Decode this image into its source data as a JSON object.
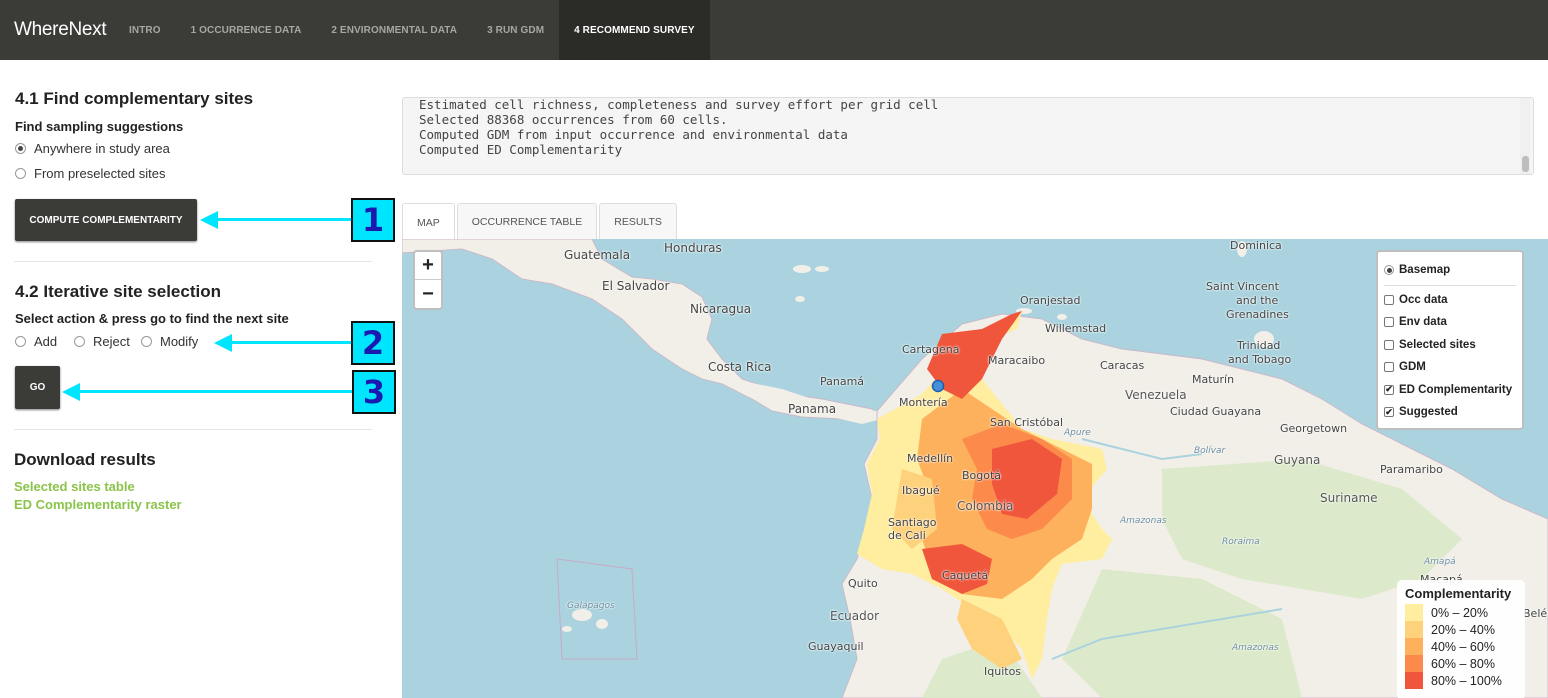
{
  "app": {
    "title": "WhereNext"
  },
  "nav": {
    "tabs": [
      {
        "label": "INTRO"
      },
      {
        "label": "1 OCCURRENCE DATA"
      },
      {
        "label": "2 ENVIRONMENTAL DATA"
      },
      {
        "label": "3 RUN GDM"
      },
      {
        "label": "4 RECOMMEND SURVEY"
      }
    ],
    "active_index": 4
  },
  "section1": {
    "title": "4.1 Find complementary sites",
    "subtitle": "Find sampling suggestions",
    "options": [
      {
        "label": "Anywhere in study area",
        "selected": true
      },
      {
        "label": "From preselected sites",
        "selected": false
      }
    ],
    "button_label": "COMPUTE COMPLEMENTARITY"
  },
  "section2": {
    "title": "4.2 Iterative site selection",
    "subtitle": "Select action & press go to find the next site",
    "options": [
      {
        "label": "Add",
        "selected": false
      },
      {
        "label": "Reject",
        "selected": false
      },
      {
        "label": "Modify",
        "selected": false
      }
    ],
    "button_label": "GO"
  },
  "download": {
    "title": "Download results",
    "links": [
      {
        "label": "Selected sites table"
      },
      {
        "label": "ED Complementarity raster"
      }
    ]
  },
  "annotations": [
    "1",
    "2",
    "3"
  ],
  "log": {
    "lines": [
      "Estimated cell richness, completeness and survey effort per grid cell",
      "Selected 88368 occurrences from 60 cells.",
      "Computed GDM from input occurrence and environmental data",
      "Computed ED Complementarity"
    ]
  },
  "tabs": [
    {
      "label": "MAP"
    },
    {
      "label": "OCCURRENCE TABLE"
    },
    {
      "label": "RESULTS"
    }
  ],
  "map": {
    "zoom_in": "+",
    "zoom_out": "−",
    "layers": [
      {
        "label": "Basemap",
        "kind": "radio",
        "checked": true
      },
      {
        "label": "Occ data",
        "kind": "checkbox",
        "checked": false
      },
      {
        "label": "Env data",
        "kind": "checkbox",
        "checked": false
      },
      {
        "label": "Selected sites",
        "kind": "checkbox",
        "checked": false
      },
      {
        "label": "GDM",
        "kind": "checkbox",
        "checked": false
      },
      {
        "label": "ED Complementarity",
        "kind": "checkbox",
        "checked": true
      },
      {
        "label": "Suggested",
        "kind": "checkbox",
        "checked": true
      }
    ],
    "legend": {
      "title": "Complementarity",
      "items": [
        {
          "label": "0% – 20%",
          "color": "#ffeda0"
        },
        {
          "label": "20% – 40%",
          "color": "#fed17c"
        },
        {
          "label": "40% – 60%",
          "color": "#feb15c"
        },
        {
          "label": "60% – 80%",
          "color": "#fc8a4a"
        },
        {
          "label": "80% – 100%",
          "color": "#f0563c"
        }
      ]
    },
    "place_labels": {
      "honduras": "Honduras",
      "guatemala": "Guatemala",
      "el_salvador": "El Salvador",
      "nicaragua": "Nicaragua",
      "costa_rica": "Costa Rica",
      "panama_city": "Panamá",
      "panama": "Panama",
      "dominica": "Dominica",
      "saint_vincent": "Saint Vincent",
      "and_the": "and the",
      "grenadines": "Grenadines",
      "oranjestad": "Oranjestad",
      "willemstad": "Willemstad",
      "cartagena": "Cartagena",
      "maracaibo": "Maracaibo",
      "trinidad": "Trinidad",
      "and_tobago": "and Tobago",
      "caracas": "Caracas",
      "maturin": "Maturín",
      "venezuela": "Venezuela",
      "ciudad_guayana": "Ciudad Guayana",
      "monteria": "Montería",
      "san_cristobal": "San Cristóbal",
      "georgetown": "Georgetown",
      "apure": "Apure",
      "bolivar": "Bolívar",
      "guyana": "Guyana",
      "paramaribo": "Paramaribo",
      "medellin": "Medellín",
      "bogota": "Bogotá",
      "ibague": "Ibagué",
      "colombia": "Colombia",
      "suriname": "Suriname",
      "santiago_de_cali": "Santiago",
      "de_cali": "de Cali",
      "amazonas": "Amazonas",
      "roraima": "Roraima",
      "amapa": "Amapá",
      "quito": "Quito",
      "macapa": "Macapá",
      "galapagos": "Galápagos",
      "caqueta": "Caquetá",
      "ecuador": "Ecuador",
      "belem": "Belém",
      "guayaquil": "Guayaquil",
      "amazonas2": "Amazonas",
      "iquitos": "Iquitos"
    }
  }
}
